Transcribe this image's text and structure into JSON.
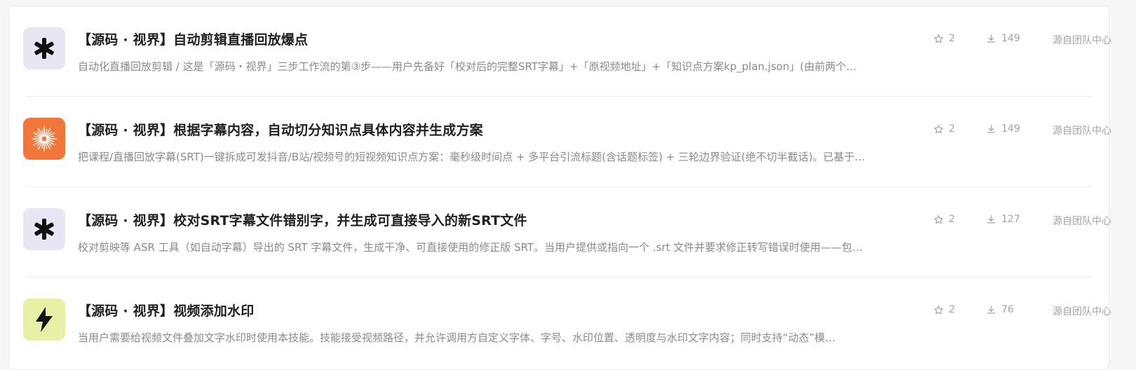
{
  "skills": [
    {
      "icon": "asterisk-icon",
      "icon_bg": "#e7e6f2",
      "icon_fg": "#111111",
      "title": "【源码 · 视界】自动剪辑直播回放爆点",
      "description": "自动化直播回放剪辑 / 这是「源码・视界」三步工作流的第③步——用户先备好「校对后的完整SRT字幕」+「原视频地址」+「知识点方案kp_plan.json」(由前两个…",
      "stars": "2",
      "downloads": "149",
      "source": "源自团队中心"
    },
    {
      "icon": "starburst-icon",
      "icon_bg": "#f2763a",
      "icon_fg": "#ffffff",
      "title": "【源码 · 视界】根据字幕内容，自动切分知识点具体内容并生成方案",
      "description": "把课程/直播回放字幕(SRT)一键拆成可发抖音/B站/视频号的短视频知识点方案：毫秒级时间点 + 多平台引流标题(含话题标签) + 三轮边界验证(绝不切半截话)。已基于…",
      "stars": "2",
      "downloads": "149",
      "source": "源自团队中心"
    },
    {
      "icon": "asterisk-icon",
      "icon_bg": "#e7e6f2",
      "icon_fg": "#111111",
      "title": "【源码 · 视界】校对SRT字幕文件错别字，并生成可直接导入的新SRT文件",
      "description": "校对剪映等 ASR 工具（如自动字幕）导出的 SRT 字幕文件，生成干净、可直接使用的修正版 SRT。当用户提供或指向一个 .srt 文件并要求修正转写错误时使用——包…",
      "stars": "2",
      "downloads": "127",
      "source": "源自团队中心"
    },
    {
      "icon": "lightning-icon",
      "icon_bg": "#e7f0a4",
      "icon_fg": "#111111",
      "title": "【源码 · 视界】视频添加水印",
      "description": "当用户需要给视频文件叠加文字水印时使用本技能。技能接受视频路径，并允许调用方自定义字体、字号、水印位置、透明度与水印文字内容；同时支持“动态”模…",
      "stars": "2",
      "downloads": "76",
      "source": "源自团队中心"
    }
  ]
}
